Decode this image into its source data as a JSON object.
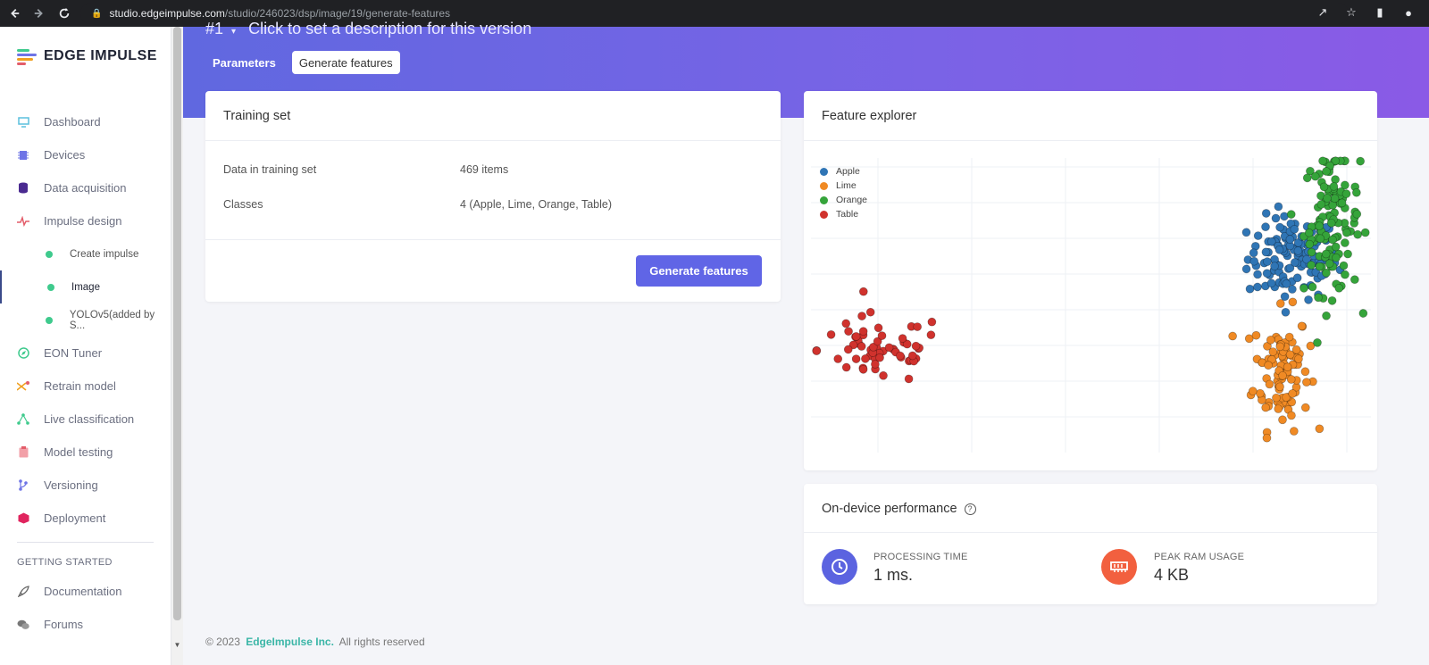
{
  "browser": {
    "url_host": "studio.edgeimpulse.com",
    "url_path": "/studio/246023/dsp/image/19/generate-features"
  },
  "sidebar": {
    "brand": "EDGE IMPULSE",
    "items": [
      {
        "label": "Dashboard",
        "icon": "monitor-icon",
        "color": "#5bc0de"
      },
      {
        "label": "Devices",
        "icon": "device-icon",
        "color": "#6e74e6"
      },
      {
        "label": "Data acquisition",
        "icon": "database-icon",
        "color": "#4a2a90"
      },
      {
        "label": "Impulse design",
        "icon": "pulse-icon",
        "color": "#e35d6a"
      },
      {
        "label": "Create impulse",
        "sub": true
      },
      {
        "label": "Image",
        "sub": true,
        "active": true
      },
      {
        "label": "YOLOv5(added by S...",
        "sub": true
      },
      {
        "label": "EON Tuner",
        "icon": "compass-icon",
        "color": "#3fca8d"
      },
      {
        "label": "Retrain model",
        "icon": "shuffle-icon",
        "color": "#f0a020"
      },
      {
        "label": "Live classification",
        "icon": "network-icon",
        "color": "#3fca8d"
      },
      {
        "label": "Model testing",
        "icon": "clipboard-icon",
        "color": "#e35d6a"
      },
      {
        "label": "Versioning",
        "icon": "branch-icon",
        "color": "#6e74e6"
      },
      {
        "label": "Deployment",
        "icon": "box-icon",
        "color": "#e0245e"
      }
    ],
    "section_heading": "GETTING STARTED",
    "help_items": [
      {
        "label": "Documentation",
        "icon": "rocket-icon"
      },
      {
        "label": "Forums",
        "icon": "chat-icon"
      }
    ]
  },
  "header": {
    "version_label": "#1",
    "version_description": "Click to set a description for this version",
    "tabs": [
      "Parameters",
      "Generate features"
    ],
    "active_tab": "Generate features"
  },
  "training_set": {
    "title": "Training set",
    "rows": [
      {
        "label": "Data in training set",
        "value": "469 items"
      },
      {
        "label": "Classes",
        "value": "4 (Apple, Lime, Orange, Table)"
      }
    ],
    "button": "Generate features"
  },
  "feature_explorer": {
    "title": "Feature explorer"
  },
  "chart_data": {
    "type": "scatter",
    "title": "",
    "xlabel": "",
    "ylabel": "",
    "grid": true,
    "legend": "top-left",
    "series": [
      {
        "name": "Apple",
        "color": "#2f75b5",
        "center": [
          0.86,
          0.66
        ],
        "spread": [
          0.04,
          0.07
        ],
        "count": 120
      },
      {
        "name": "Lime",
        "color": "#f08a24",
        "center": [
          0.84,
          0.28
        ],
        "spread": [
          0.025,
          0.1
        ],
        "count": 100
      },
      {
        "name": "Orange",
        "color": "#35a43a",
        "center": [
          0.93,
          0.78
        ],
        "spread": [
          0.025,
          0.12
        ],
        "count": 120
      },
      {
        "name": "Table",
        "color": "#d0322d",
        "center": [
          0.12,
          0.35
        ],
        "spread": [
          0.06,
          0.06
        ],
        "count": 60
      }
    ]
  },
  "performance": {
    "title": "On-device performance",
    "processing_label": "PROCESSING TIME",
    "processing_value": "1 ms.",
    "ram_label": "PEAK RAM USAGE",
    "ram_value": "4 KB"
  },
  "footer": {
    "copyright": "© 2023",
    "company": "EdgeImpulse Inc.",
    "rights": "All rights reserved"
  },
  "colors": {
    "accent": "#6065e6",
    "banner_start": "#6068e0",
    "banner_end": "#8a5ae6",
    "clock_icon_bg": "#5b63e0",
    "ram_icon_bg": "#f2603f",
    "active_dot": "#3fca8d"
  }
}
